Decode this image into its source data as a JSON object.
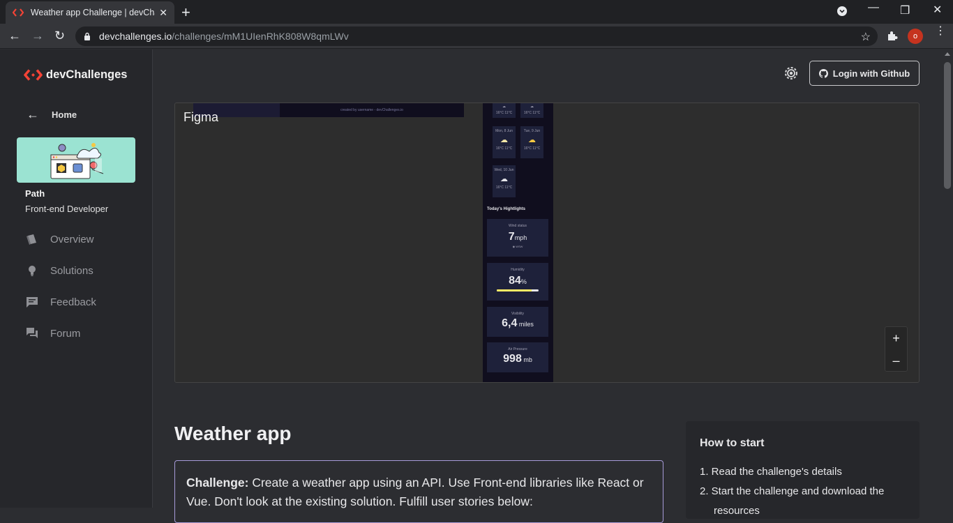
{
  "browser": {
    "tab_title": "Weather app Challenge | devChallenges",
    "url_host": "devchallenges.io",
    "url_path": "/challenges/mM1UIenRhK808W8qmLWv",
    "avatar_letter": "o"
  },
  "sidebar": {
    "brand": "devChallenges",
    "home_label": "Home",
    "path_label": "Path",
    "path_value": "Front-end Developer",
    "items": [
      {
        "label": "Overview",
        "icon": "book-icon"
      },
      {
        "label": "Solutions",
        "icon": "lightbulb-icon"
      },
      {
        "label": "Feedback",
        "icon": "feedback-icon"
      },
      {
        "label": "Forum",
        "icon": "forum-icon"
      }
    ]
  },
  "header": {
    "login_label": "Login with Github"
  },
  "figma": {
    "label": "Figma",
    "footer_text": "created by username - devChallenges.io",
    "forecast": [
      {
        "day": "",
        "temp": "16°C  11°C"
      },
      {
        "day": "",
        "temp": "16°C  11°C"
      },
      {
        "day": "Mon, 8 Jun",
        "temp": "16°C  11°C"
      },
      {
        "day": "Tue, 9 Jun",
        "temp": "16°C  11°C"
      },
      {
        "day": "Wed, 10 Jun",
        "temp": "16°C  11°C"
      }
    ],
    "highlights_title": "Today's Hightlights",
    "highlights": [
      {
        "title": "Wind status",
        "value": "7",
        "unit": "mph",
        "extra": "WSW"
      },
      {
        "title": "Humidity",
        "value": "84",
        "unit": "%",
        "extra": ""
      },
      {
        "title": "Visibility",
        "value": "6,4",
        "unit": " miles",
        "extra": ""
      },
      {
        "title": "Air Pressure",
        "value": "998",
        "unit": " mb",
        "extra": ""
      }
    ],
    "humidity_level": 0.84,
    "zoom_in": "+",
    "zoom_out": "–"
  },
  "main": {
    "title": "Weather app",
    "challenge_label": "Challenge:",
    "challenge_text": " Create a weather app using an API. Use Front-end libraries like React or Vue. Don't look at the existing solution. Fulfill user stories below:",
    "howto_title": "How to start",
    "howto_steps": [
      "1. Read the challenge's details",
      "2. Start the challenge and download the resources"
    ]
  },
  "colors": {
    "brand_red": "#f44336",
    "accent_purple": "#a79bd9"
  }
}
